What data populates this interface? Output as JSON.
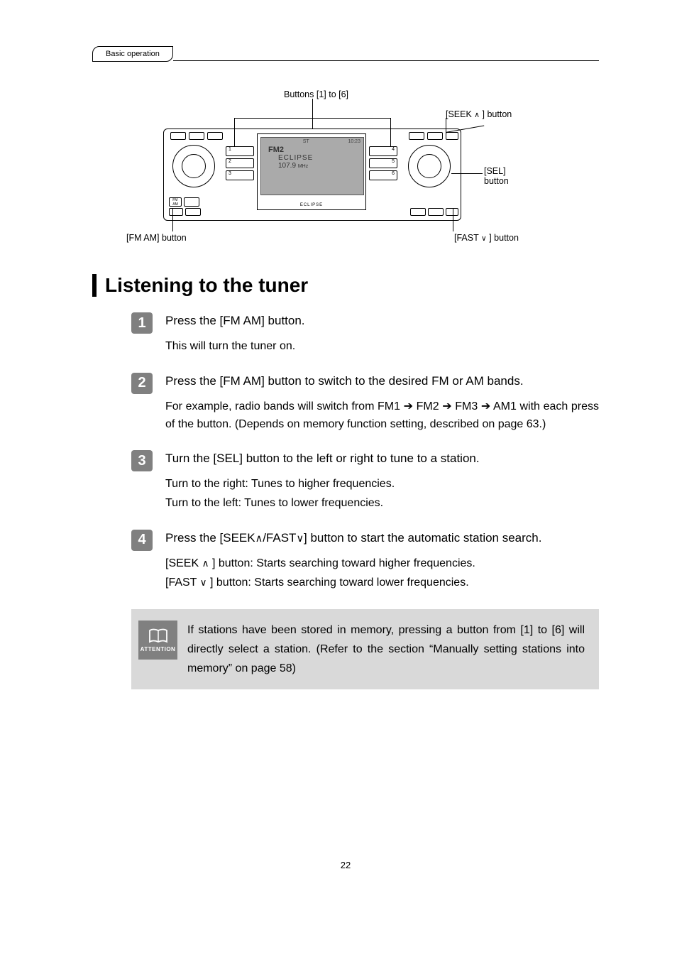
{
  "breadcrumb": "Basic operation",
  "diagram": {
    "label_buttons": "Buttons [1] to [6]",
    "label_seek": "[SEEK    ] button",
    "label_sel": "[SEL] button",
    "label_fmam": "[FM AM] button",
    "label_fast": "[FAST    ] button",
    "display_band": "FM2",
    "display_name": "ECLIPSE",
    "display_freq": "107.9",
    "display_unit": "MHz",
    "display_st": "ST",
    "display_time": "10:23"
  },
  "heading": "Listening to the tuner",
  "steps": [
    {
      "num": "1",
      "title": "Press the [FM AM] button.",
      "desc": "This will turn the tuner on."
    },
    {
      "num": "2",
      "title": "Press the [FM AM] button to switch to the desired FM or AM bands.",
      "desc": "For example, radio bands will switch from FM1 ➔ FM2 ➔ FM3 ➔ AM1 with each press of the button. (Depends on memory function setting, described on page 63.)"
    },
    {
      "num": "3",
      "title": "Turn the [SEL] button to the left or right to tune to a station.",
      "desc_right": "Turn to the right:  Tunes to higher frequencies.",
      "desc_left": "Turn to the left:    Tunes to lower frequencies."
    },
    {
      "num": "4",
      "title_a": "Press the [SEEK",
      "title_b": "/FAST",
      "title_c": "] button to start the automatic station search.",
      "desc_seek_a": "[SEEK ",
      "desc_seek_b": " ] button:  Starts searching toward higher frequencies.",
      "desc_fast_a": "[FAST ",
      "desc_fast_b": " ] button:  Starts searching toward lower frequencies."
    }
  ],
  "attention": {
    "label": "ATTENTION",
    "text": "If stations have been stored in memory, pressing a button from [1] to [6] will directly select a station. (Refer to the section “Manually setting stations into memory” on page 58)"
  },
  "page_num": "22"
}
